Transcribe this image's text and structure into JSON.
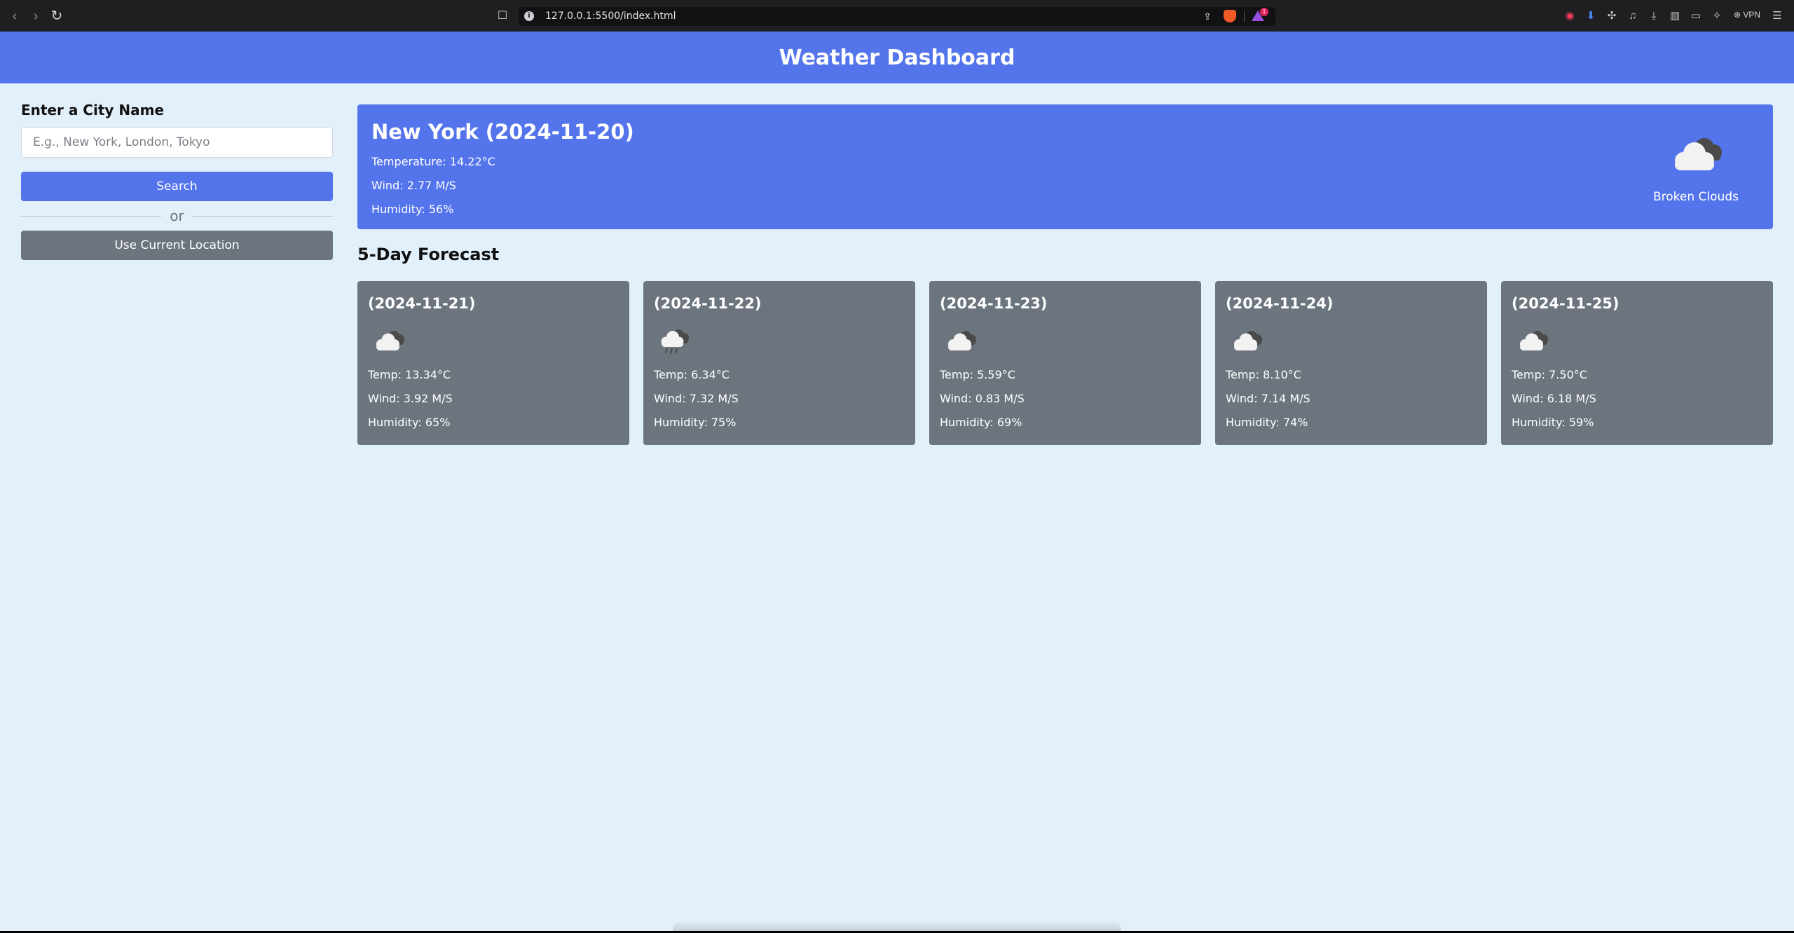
{
  "browser": {
    "url": "127.0.0.1:5500/index.html",
    "rewards_badge": "1",
    "vpn_label": "VPN"
  },
  "app": {
    "title": "Weather Dashboard"
  },
  "sidebar": {
    "city_label": "Enter a City Name",
    "city_placeholder": "E.g., New York, London, Tokyo",
    "city_value": "",
    "search_label": "Search",
    "or_label": "or",
    "location_label": "Use Current Location"
  },
  "current": {
    "city_date": "New York (2024-11-20)",
    "temperature": "Temperature: 14.22°C",
    "wind": "Wind: 2.77 M/S",
    "humidity": "Humidity: 56%",
    "icon": "broken-clouds-icon",
    "description": "Broken Clouds"
  },
  "forecast": {
    "title": "5-Day Forecast",
    "days": [
      {
        "date": "(2024-11-21)",
        "icon": "broken-clouds-icon",
        "temp": "Temp: 13.34°C",
        "wind": "Wind: 3.92 M/S",
        "humidity": "Humidity: 65%"
      },
      {
        "date": "(2024-11-22)",
        "icon": "rain-icon",
        "temp": "Temp: 6.34°C",
        "wind": "Wind: 7.32 M/S",
        "humidity": "Humidity: 75%"
      },
      {
        "date": "(2024-11-23)",
        "icon": "broken-clouds-icon",
        "temp": "Temp: 5.59°C",
        "wind": "Wind: 0.83 M/S",
        "humidity": "Humidity: 69%"
      },
      {
        "date": "(2024-11-24)",
        "icon": "broken-clouds-icon",
        "temp": "Temp: 8.10°C",
        "wind": "Wind: 7.14 M/S",
        "humidity": "Humidity: 74%"
      },
      {
        "date": "(2024-11-25)",
        "icon": "broken-clouds-icon",
        "temp": "Temp: 7.50°C",
        "wind": "Wind: 6.18 M/S",
        "humidity": "Humidity: 59%"
      }
    ]
  },
  "colors": {
    "header": "#5474ec",
    "page_background": "#e2f0fb",
    "forecast_card": "#6c757d",
    "location_button": "#6c757d"
  }
}
